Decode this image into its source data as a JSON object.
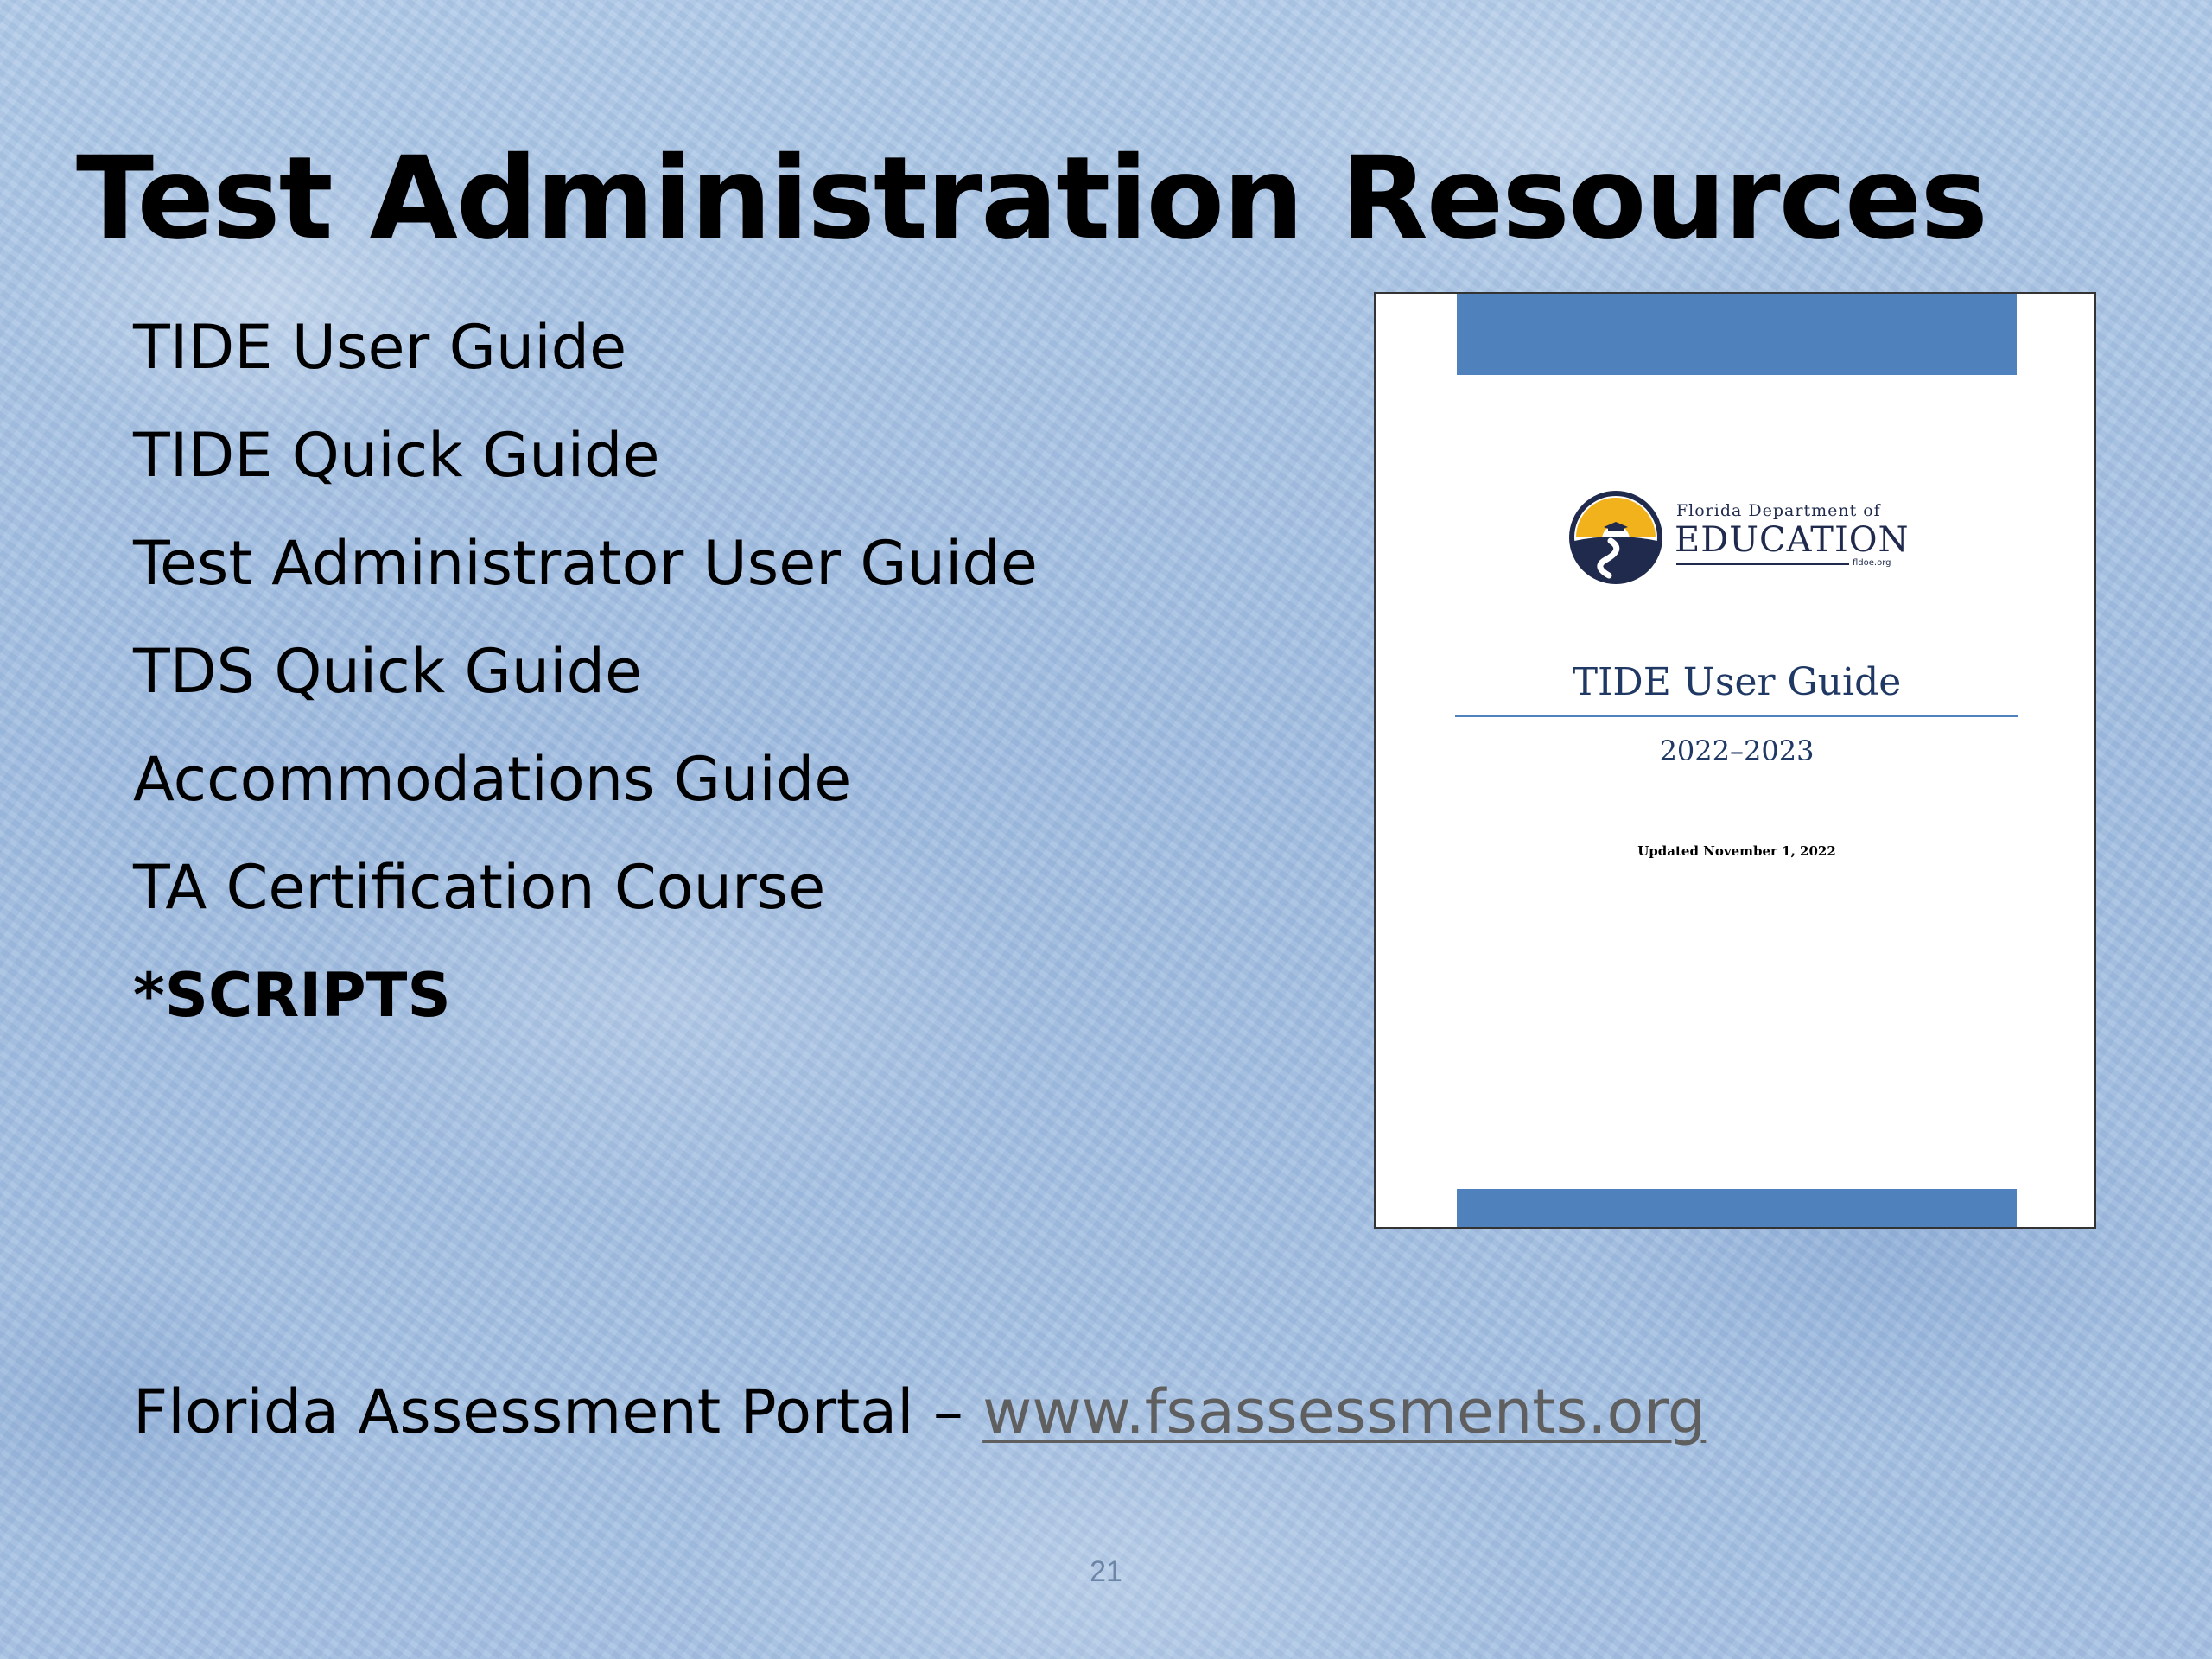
{
  "slide": {
    "title": "Test Administration Resources",
    "resources": [
      {
        "label": "TIDE User Guide",
        "bold": false
      },
      {
        "label": "TIDE Quick Guide",
        "bold": false
      },
      {
        "label": "Test Administrator User Guide",
        "bold": false
      },
      {
        "label": "TDS Quick Guide",
        "bold": false
      },
      {
        "label": "Accommodations Guide",
        "bold": false
      },
      {
        "label": "TA Certification Course",
        "bold": false
      },
      {
        "label": "*SCRIPTS",
        "bold": true
      }
    ],
    "portal": {
      "label": "Florida Assessment Portal – ",
      "link_text": "www.fsassessments.org"
    },
    "slide_number": "21"
  },
  "cover": {
    "logo_line1": "Florida Department of",
    "logo_line2": "EDUCATION",
    "logo_url": "fldoe.org",
    "doc_title": "TIDE User Guide",
    "doc_year": "2022–2023",
    "updated": "Updated November 1, 2022",
    "accent_color": "#4f81bd"
  },
  "colors": {
    "background": "#a9c4e4",
    "text": "#000000",
    "link": "#5f5f5f",
    "logo_navy": "#1f2a4d",
    "logo_gold": "#f2b21b"
  },
  "icons": {
    "logo": "florida-doe-seal-icon"
  }
}
